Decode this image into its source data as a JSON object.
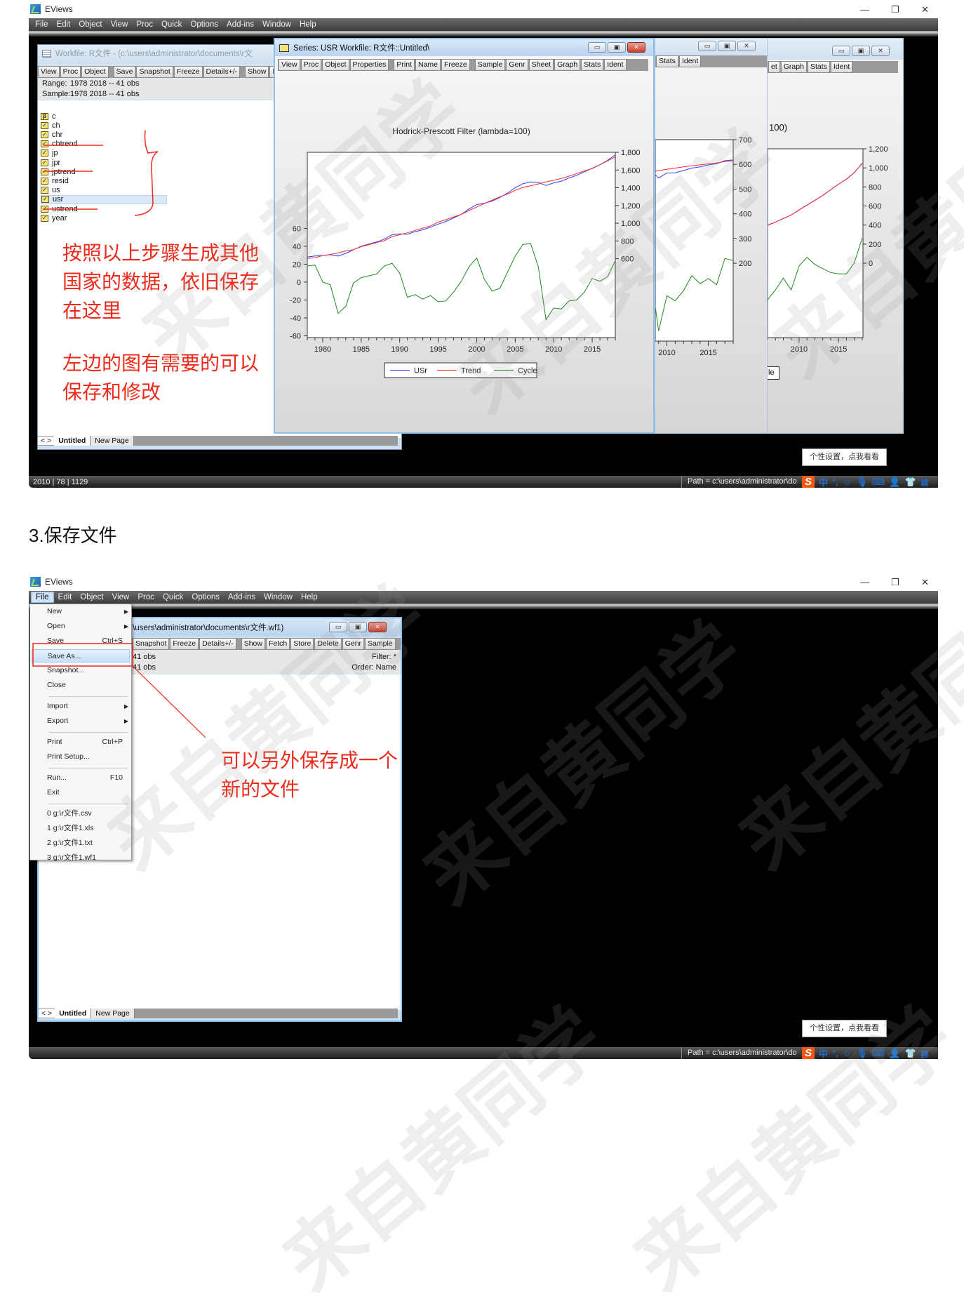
{
  "app": {
    "title": "EViews",
    "menu": [
      "File",
      "Edit",
      "Object",
      "View",
      "Proc",
      "Quick",
      "Options",
      "Add-ins",
      "Window",
      "Help"
    ],
    "window_controls": [
      "minimize-icon",
      "restore-icon",
      "close-icon"
    ]
  },
  "screen1": {
    "workfile": {
      "title": "Workfile: R文件 - (c:\\users\\administrator\\documents\\r文",
      "toolbar": [
        [
          "View",
          "Proc",
          "Object"
        ],
        [
          "Save",
          "Snapshot",
          "Freeze",
          "Details+/-"
        ],
        [
          "Show",
          "F"
        ]
      ],
      "range_label": "Range:",
      "range_value": "1978 2018   --   41 obs",
      "sample_label": "Sample:",
      "sample_value": "1978 2018   --   41 obs",
      "objects": [
        {
          "name": "c",
          "icon": "beta-icon"
        },
        {
          "name": "ch",
          "icon": "series-icon"
        },
        {
          "name": "chr",
          "icon": "series-icon"
        },
        {
          "name": "chtrend",
          "icon": "series-icon"
        },
        {
          "name": "jp",
          "icon": "series-icon"
        },
        {
          "name": "jpr",
          "icon": "series-icon"
        },
        {
          "name": "jptrend",
          "icon": "series-icon"
        },
        {
          "name": "resid",
          "icon": "series-icon"
        },
        {
          "name": "us",
          "icon": "series-icon"
        },
        {
          "name": "usr",
          "icon": "series-icon"
        },
        {
          "name": "ustrend",
          "icon": "series-icon"
        },
        {
          "name": "year",
          "icon": "series-icon"
        }
      ],
      "selected_object": "usr",
      "tabs": [
        "Untitled",
        "New Page"
      ],
      "tab_nav": "< >"
    },
    "annotation_1": [
      "按照以上步骤生成其他",
      "国家的数据，依旧保存",
      "在这里"
    ],
    "annotation_2": [
      "左边的图有需要的可以",
      "保存和修改"
    ],
    "annotation_color": "#ee2a1a",
    "series_window": {
      "title": "Series: USR   Workfile: R文件::Untitled\\",
      "toolbar": [
        [
          "View",
          "Proc",
          "Object",
          "Properties"
        ],
        [
          "Print",
          "Name",
          "Freeze"
        ],
        [
          "Sample",
          "Genr",
          "Sheet",
          "Graph",
          "Stats",
          "Ident"
        ]
      ]
    },
    "window_a": {
      "toolbar": [
        [
          "Stats",
          "Ident"
        ]
      ]
    },
    "window_b": {
      "toolbar": [
        [
          "et",
          "Graph",
          "Stats",
          "Ident"
        ]
      ],
      "title_fragment": "100)",
      "legend_fragment": "le"
    },
    "status": {
      "left": "2010 | 78 | 1129",
      "path": "Path = c:\\users\\administrator\\do"
    },
    "tooltip": "个性设置，点我看看",
    "ime_icons": [
      "sogou-logo-icon",
      "chinese-mode-icon",
      "punctuation-icon",
      "emoji-icon",
      "microphone-icon",
      "keyboard-icon",
      "user-icon",
      "skin-shirt-icon",
      "toolbox-grid-icon"
    ],
    "ime_labels": {
      "logo": "S",
      "mode": "中",
      "punct": "°,"
    }
  },
  "section_heading": "3.保存文件",
  "screen2": {
    "workfile": {
      "title_visible": "\\users\\administrator\\documents\\r文件.wf1)",
      "toolbar_visible": [
        [
          "Snapshot",
          "Freeze",
          "Details+/-"
        ],
        [
          "Show",
          "Fetch",
          "Store",
          "Delete",
          "Genr",
          "Sample"
        ]
      ],
      "range_visible": "41 obs",
      "sample_visible": "41 obs",
      "filter": "Filter: *",
      "order": "Order: Name",
      "tabs": [
        "Untitled",
        "New Page"
      ],
      "tab_nav": "< >"
    },
    "file_menu": [
      {
        "label": "New",
        "submenu": true
      },
      {
        "label": "Open",
        "submenu": true
      },
      {
        "label": "Save",
        "shortcut": "Ctrl+S"
      },
      {
        "label": "Save As...",
        "highlighted": true
      },
      {
        "label": "Snapshot..."
      },
      {
        "label": "Close"
      },
      {
        "label": "Import",
        "submenu": true,
        "separator_before": true
      },
      {
        "label": "Export",
        "submenu": true
      },
      {
        "label": "Print",
        "shortcut": "Ctrl+P",
        "separator_before": true
      },
      {
        "label": "Print Setup..."
      },
      {
        "label": "Run...",
        "shortcut": "F10",
        "separator_before": true
      },
      {
        "label": "Exit"
      },
      {
        "label": "0 g:\\r文件.csv",
        "separator_before": true
      },
      {
        "label": "1 g:\\r文件1.xls"
      },
      {
        "label": "2 g:\\r文件1.txt"
      },
      {
        "label": "3 g:\\r文件1.wf1"
      }
    ],
    "annotation": [
      "可以另外保存成一个",
      "新的文件"
    ],
    "status": {
      "path": "Path = c:\\users\\administrator\\do"
    },
    "tooltip": "个性设置，点我看看",
    "ime_labels": {
      "logo": "S",
      "mode": "中",
      "punct": "°,"
    }
  },
  "watermark": "来自黄同学",
  "chart_data": [
    {
      "type": "line",
      "title": "Hodrick-Prescott Filter (lambda=100)",
      "x": [
        1978,
        1979,
        1980,
        1981,
        1982,
        1983,
        1984,
        1985,
        1986,
        1987,
        1988,
        1989,
        1990,
        1991,
        1992,
        1993,
        1994,
        1995,
        1996,
        1997,
        1998,
        1999,
        2000,
        2001,
        2002,
        2003,
        2004,
        2005,
        2006,
        2007,
        2008,
        2009,
        2010,
        2011,
        2012,
        2013,
        2014,
        2015,
        2016,
        2017,
        2018
      ],
      "xlim": [
        1978,
        2018
      ],
      "x_ticks": [
        "1980",
        "1985",
        "1990",
        "1995",
        "2000",
        "2005",
        "2010",
        "2015"
      ],
      "y_right_range": [
        -290,
        1800
      ],
      "y_right_ticks": [
        "600",
        "800",
        "1,000",
        "1,200",
        "1,400",
        "1,600",
        "1,800"
      ],
      "y_left_range": [
        -62,
        145
      ],
      "y_left_ticks": [
        "-60",
        "-40",
        "-20",
        "0",
        "20",
        "40",
        "60"
      ],
      "legend_placement": "bottom",
      "grid": false,
      "series": [
        {
          "name": "USr",
          "axis": "right",
          "color": "#2a3cff",
          "values": [
            620,
            630,
            635,
            645,
            630,
            660,
            700,
            740,
            765,
            790,
            820,
            870,
            880,
            875,
            905,
            925,
            955,
            990,
            1020,
            1060,
            1100,
            1160,
            1210,
            1225,
            1250,
            1290,
            1340,
            1400,
            1445,
            1465,
            1460,
            1425,
            1455,
            1475,
            1510,
            1540,
            1580,
            1620,
            1660,
            1710,
            1770
          ]
        },
        {
          "name": "Trend",
          "axis": "right",
          "color": "#ff2a2a",
          "values": [
            602,
            611,
            635,
            648,
            665,
            687,
            701,
            735,
            758,
            781,
            802,
            849,
            870,
            892,
            919,
            944,
            970,
            1012,
            1041,
            1071,
            1099,
            1143,
            1183,
            1222,
            1260,
            1297,
            1329,
            1371,
            1403,
            1422,
            1443,
            1467,
            1484,
            1505,
            1531,
            1560,
            1591,
            1616,
            1659,
            1704,
            1746
          ]
        },
        {
          "name": "Cycle",
          "axis": "left",
          "color": "#1e8a1e",
          "values": [
            18,
            19,
            0,
            -3,
            -35,
            -27,
            -1,
            5,
            7,
            9,
            18,
            21,
            10,
            -17,
            -14,
            -19,
            -15,
            -22,
            -21,
            -11,
            1,
            17,
            27,
            3,
            -10,
            -7,
            11,
            29,
            42,
            43,
            17,
            -42,
            -29,
            -30,
            -21,
            -20,
            -11,
            4,
            1,
            6,
            24
          ]
        }
      ]
    },
    {
      "type": "line",
      "x": [
        2008,
        2009,
        2010,
        2011,
        2012,
        2013,
        2014,
        2015,
        2016,
        2017,
        2018
      ],
      "xlim": [
        2008.6,
        2018
      ],
      "x_ticks": [
        "2010",
        "2015"
      ],
      "y_right_range": [
        -115,
        700
      ],
      "y_right_ticks": [
        "200",
        "300",
        "400",
        "500",
        "600",
        "700"
      ],
      "y_left_range": [
        -60,
        140
      ],
      "series": [
        {
          "axis": "right",
          "color": "#2a3cff",
          "values": [
            580,
            545,
            565,
            566,
            575,
            585,
            590,
            598,
            603,
            615,
            618
          ]
        },
        {
          "axis": "right",
          "color": "#ff2a2a",
          "values": [
            570,
            575,
            580,
            585,
            590,
            594,
            598,
            602,
            606,
            611,
            615
          ]
        },
        {
          "axis": "left",
          "color": "#1e8a1e",
          "values": [
            10,
            -50,
            -15,
            -20,
            -10,
            5,
            -3,
            2,
            -4,
            22,
            20
          ]
        }
      ]
    },
    {
      "type": "line",
      "x": [
        2006,
        2007,
        2008,
        2009,
        2010,
        2011,
        2012,
        2013,
        2014,
        2015,
        2016,
        2017,
        2018
      ],
      "xlim": [
        2006,
        2018.1
      ],
      "x_ticks": [
        "2010",
        "2015"
      ],
      "y_right_range": [
        -780,
        1200
      ],
      "y_right_ticks": [
        "0",
        "200",
        "400",
        "600",
        "800",
        "1,000",
        "1,200"
      ],
      "y_left_range": [
        -100,
        300
      ],
      "series": [
        {
          "axis": "right",
          "color": "#2a3cff",
          "values": [
            400,
            430,
            470,
            505,
            560,
            610,
            660,
            710,
            770,
            830,
            880,
            950,
            1050
          ]
        },
        {
          "axis": "right",
          "color": "#ff2a2a",
          "values": [
            398,
            430,
            468,
            505,
            558,
            608,
            660,
            712,
            770,
            828,
            882,
            952,
            1045
          ]
        },
        {
          "axis": "left",
          "color": "#1e8a1e",
          "values": [
            -20,
            1,
            26,
            1,
            52,
            70,
            55,
            46,
            38,
            35,
            35,
            58,
            111
          ]
        }
      ]
    }
  ]
}
